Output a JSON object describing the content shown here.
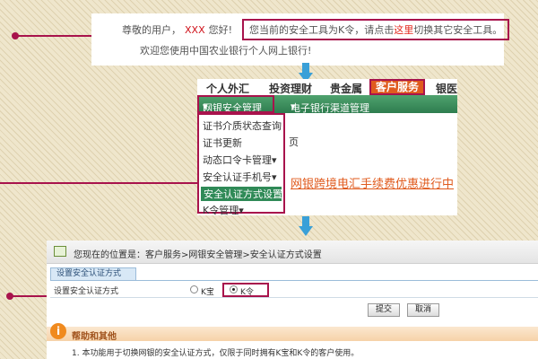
{
  "panel1": {
    "greeting_prefix": "尊敬的用户，",
    "user_name": "XXX",
    "greeting_suffix": "您好!",
    "tool_notice_prefix": "您当前的安全工具为K令，请点击",
    "tool_notice_link": "这里",
    "tool_notice_suffix": "切换其它安全工具。",
    "welcome": "欢迎您使用中国农业银行个人网上银行!"
  },
  "panel2": {
    "top_nav": [
      "个人外汇",
      "投资理财",
      "贵金属",
      "客户服务",
      "银医"
    ],
    "active_nav": "客户服务",
    "menu_bar": [
      "网银安全管理",
      "电子银行渠道管理"
    ],
    "dropdown": [
      "证书介质状态查询",
      "证书更新",
      "动态口令卡管理",
      "安全认证手机号",
      "安全认证方式设置",
      "K令管理"
    ],
    "selected_item": "安全认证方式设置",
    "page_fragment": "页",
    "promo": "网银跨境电汇手续费优惠进行中"
  },
  "panel3": {
    "breadcrumb": "您现在的位置是：客户服务>网银安全管理>安全认证方式设置",
    "tab": "设置安全认证方式",
    "form_label": "设置安全认证方式",
    "options": [
      {
        "label": "K宝",
        "selected": false
      },
      {
        "label": "K令",
        "selected": true
      }
    ],
    "submit": "提交",
    "cancel": "取消",
    "help_title": "帮助和其他",
    "help_text": "1. 本功能用于切换网银的安全认证方式，仅限于同时拥有K宝和K令的客户使用。"
  },
  "colors": {
    "callout": "#a8134c",
    "green_menu": "#2e7d4f",
    "accent_orange": "#e05b1e",
    "arrow_blue": "#3aa0d8"
  }
}
